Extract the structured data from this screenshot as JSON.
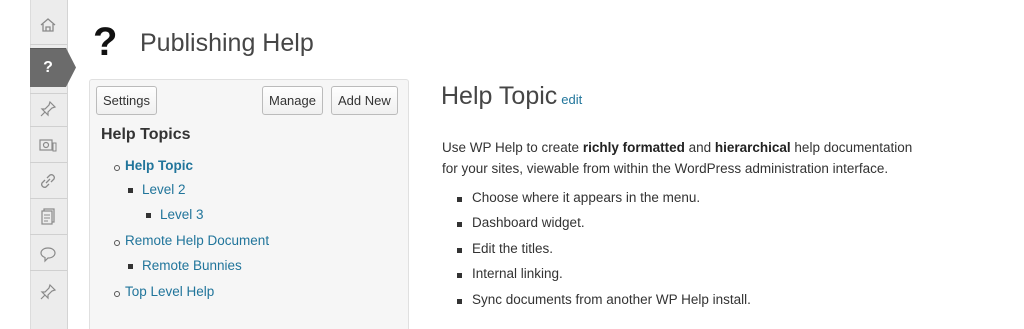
{
  "sidebar": {
    "items": [
      {
        "icon": "dashboard-icon"
      },
      {
        "icon": "help-icon",
        "label": "?",
        "active": true
      },
      {
        "icon": "posts-pin-icon"
      },
      {
        "icon": "media-icon"
      },
      {
        "icon": "links-icon"
      },
      {
        "icon": "pages-icon"
      },
      {
        "icon": "comments-icon"
      },
      {
        "icon": "pin-icon"
      }
    ]
  },
  "header": {
    "icon_glyph": "?",
    "title": "Publishing Help"
  },
  "panel": {
    "settings_label": "Settings",
    "manage_label": "Manage",
    "add_new_label": "Add New",
    "heading": "Help Topics",
    "tree": [
      {
        "label": "Help Topic",
        "level": 0,
        "current": true
      },
      {
        "label": "Level 2",
        "level": 1
      },
      {
        "label": "Level 3",
        "level": 2
      },
      {
        "label": "Remote Help Document",
        "level": 0
      },
      {
        "label": "Remote Bunnies",
        "level": 1
      },
      {
        "label": "Top Level Help",
        "level": 0
      }
    ]
  },
  "content": {
    "title": "Help Topic",
    "edit_label": "edit",
    "intro_1": "Use WP Help to create ",
    "intro_bold_1": "richly formatted",
    "intro_2": " and ",
    "intro_bold_2": "hierarchical",
    "intro_3": " help documentation",
    "intro_line2": "for your sites, viewable from within the WordPress administration interface.",
    "features": [
      "Choose where it appears in the menu.",
      "Dashboard widget.",
      "Edit the titles.",
      "Internal linking.",
      "Sync documents from another WP Help install."
    ]
  },
  "colors": {
    "link": "#21759b",
    "sidebar_bg": "#ececec",
    "active_menu": "#6b6b6b"
  }
}
